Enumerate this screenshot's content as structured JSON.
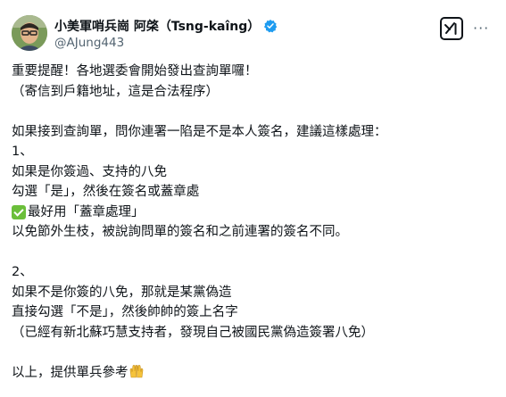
{
  "author": {
    "display_name": "小美軍哨兵崗 阿棨（Tsng-kaîng）",
    "handle": "@AJung443",
    "verified": true,
    "verified_color": "#1d9bf0",
    "avatar_icon": "avatar-photo"
  },
  "actions": {
    "grok_icon": "grok-icon",
    "more_label": "···"
  },
  "tweet": {
    "lines": [
      "重要提醒！各地選委會開始發出查詢單囉！",
      "（寄信到戶籍地址，這是合法程序）",
      "",
      "如果接到查詢單，問你連署一陷是不是本人簽名，建議這樣處理：",
      "1、",
      "如果是你簽過、支持的八免",
      "勾選「是」，然後在簽名或蓋章處",
      "最好用「蓋章處理」",
      "以免節外生枝，被說詢問單的簽名和之前連署的簽名不同。",
      "",
      "2、",
      "如果不是你簽的八免，那就是某黨偽造",
      "直接勾選「不是」，然後帥帥的簽上名字",
      "（已經有新北蘇巧慧支持者，發現自己被國民黨偽造簽署八免）",
      "",
      "以上，提供單兵參考"
    ],
    "check_emoji": "check-mark-button-emoji",
    "hands_emoji": "raising-hands-emoji"
  }
}
